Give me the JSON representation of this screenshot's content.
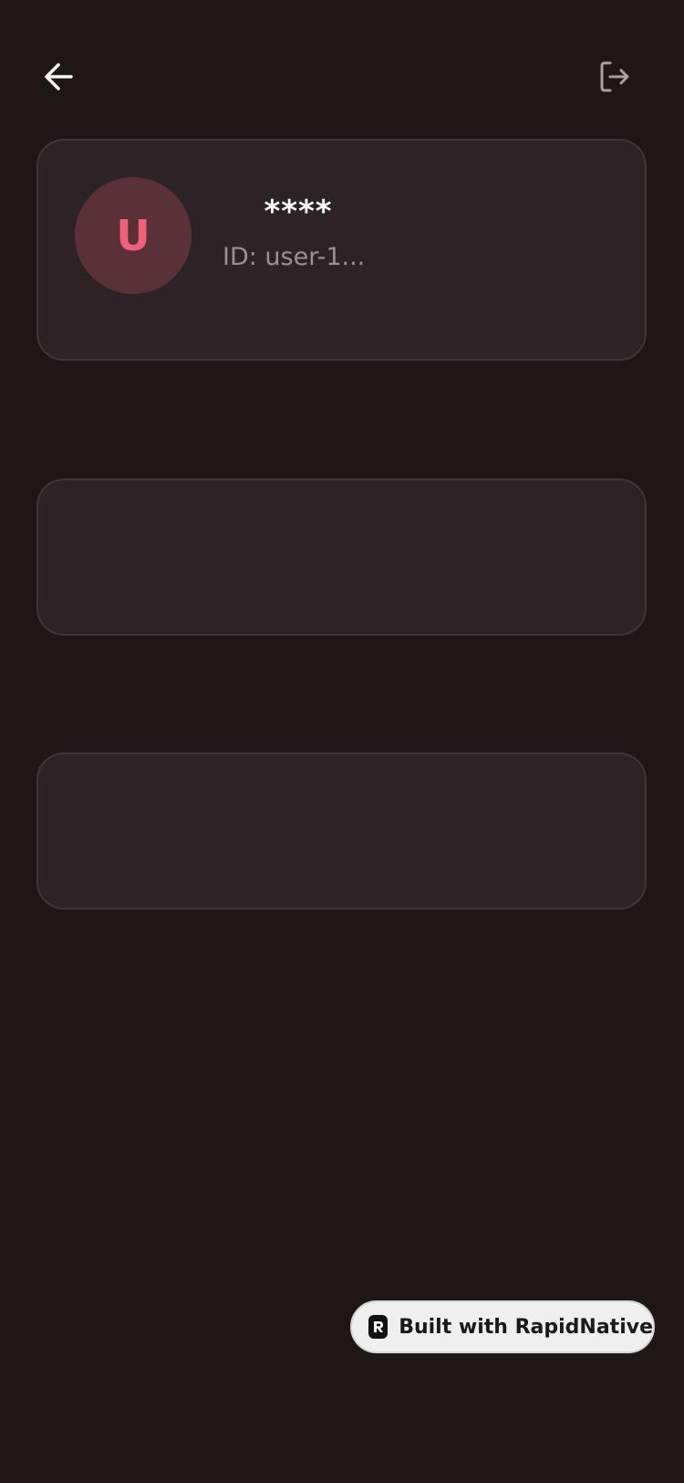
{
  "header": {
    "back_icon": "arrow-left-icon",
    "logout_icon": "logout-icon"
  },
  "profile": {
    "avatar_initial": "U",
    "username": "****",
    "user_id": "ID: user-1..."
  },
  "badge": {
    "label": "Built with RapidNative",
    "icon": "rapidnative-logo-icon"
  },
  "colors": {
    "background": "#1e1617",
    "card": "#2b2326",
    "card_border": "#403639",
    "avatar_bg": "#5a3138",
    "avatar_text": "#f0607a",
    "muted_text": "#9a9194"
  }
}
